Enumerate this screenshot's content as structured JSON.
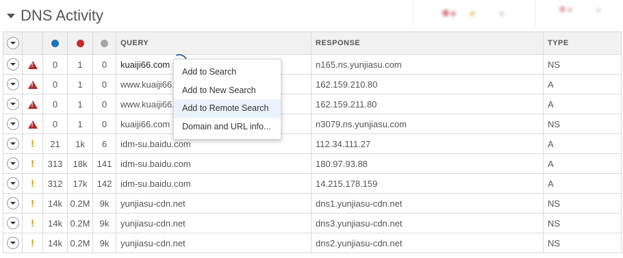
{
  "panel": {
    "title": "DNS Activity"
  },
  "colors": {
    "blue": "#1d72b8",
    "red": "#c62c2c",
    "grey": "#a6a6a6",
    "warn_red": "#b52a2a",
    "warn_orange": "#e09a1c"
  },
  "columns": {
    "query": "QUERY",
    "response": "RESPONSE",
    "type": "TYPE"
  },
  "rows": [
    {
      "severity": "high",
      "blue": "0",
      "red": "1",
      "grey": "0",
      "query": "kuaiji66.com",
      "response": "n165.ns.yunjiasu.com",
      "type": "NS"
    },
    {
      "severity": "high",
      "blue": "0",
      "red": "1",
      "grey": "0",
      "query": "www.kuaiji66.com",
      "response": "162.159.210.80",
      "type": "A"
    },
    {
      "severity": "high",
      "blue": "0",
      "red": "1",
      "grey": "0",
      "query": "www.kuaiji66.com",
      "response": "162.159.211.80",
      "type": "A"
    },
    {
      "severity": "high",
      "blue": "0",
      "red": "1",
      "grey": "0",
      "query": "kuaiji66.com",
      "response": "n3079.ns.yunjiasu.com",
      "type": "NS"
    },
    {
      "severity": "medium",
      "blue": "21",
      "red": "1k",
      "grey": "6",
      "query": "idm-su.baidu.com",
      "response": "112.34.111.27",
      "type": "A"
    },
    {
      "severity": "medium",
      "blue": "313",
      "red": "18k",
      "grey": "141",
      "query": "idm-su.baidu.com",
      "response": "180.97.93.88",
      "type": "A"
    },
    {
      "severity": "medium",
      "blue": "312",
      "red": "17k",
      "grey": "142",
      "query": "idm-su.baidu.com",
      "response": "14.215.178.159",
      "type": "A"
    },
    {
      "severity": "medium",
      "blue": "14k",
      "red": "0.2M",
      "grey": "9k",
      "query": "yunjiasu-cdn.net",
      "response": "dns1.yunjiasu-cdn.net",
      "type": "NS"
    },
    {
      "severity": "medium",
      "blue": "14k",
      "red": "0.2M",
      "grey": "9k",
      "query": "yunjiasu-cdn.net",
      "response": "dns3.yunjiasu-cdn.net",
      "type": "NS"
    },
    {
      "severity": "medium",
      "blue": "14k",
      "red": "0.2M",
      "grey": "9k",
      "query": "yunjiasu-cdn.net",
      "response": "dns2.yunjiasu-cdn.net",
      "type": "NS"
    }
  ],
  "context_menu": {
    "items": [
      "Add to Search",
      "Add to New Search",
      "Add to Remote Search",
      "Domain and URL info..."
    ],
    "hovered": "Add to Remote Search"
  }
}
